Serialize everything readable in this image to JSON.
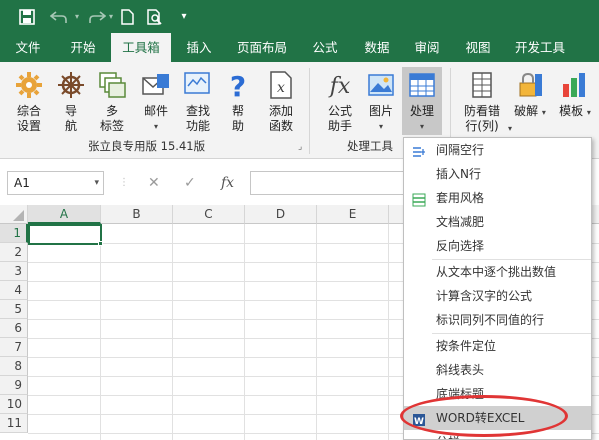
{
  "titlebar": {
    "save_icon": "save-icon",
    "undo_icon": "undo-icon",
    "redo_icon": "redo-icon",
    "new_icon": "new-doc-icon",
    "preview_icon": "print-preview-icon",
    "customize_icon": "customize-qa-icon",
    "bg_color": "#217346"
  },
  "tabs": [
    {
      "label": "文件"
    },
    {
      "label": "开始"
    },
    {
      "label": "工具箱"
    },
    {
      "label": "插入"
    },
    {
      "label": "页面布局"
    },
    {
      "label": "公式"
    },
    {
      "label": "数据"
    },
    {
      "label": "审阅"
    },
    {
      "label": "视图"
    },
    {
      "label": "开发工具"
    }
  ],
  "ribbon": {
    "buttons": [
      {
        "label": "综合\n设置",
        "icon": "settings-icon"
      },
      {
        "label": "导\n航",
        "icon": "helm-icon"
      },
      {
        "label": "多\n标签",
        "icon": "multi-tab-icon"
      },
      {
        "label": "邮件",
        "icon": "mail-icon",
        "caret": "▾"
      },
      {
        "label": "查找\n功能",
        "icon": "find-icon"
      },
      {
        "label": "帮\n助",
        "icon": "help-icon"
      },
      {
        "label": "添加\n函数",
        "icon": "add-function-icon"
      },
      {
        "label": "公式\n助手",
        "icon": "fx-icon"
      },
      {
        "label": "图片",
        "icon": "picture-icon",
        "caret": "▾"
      },
      {
        "label": "处理",
        "icon": "process-icon",
        "caret": "▾"
      },
      {
        "label": "防看错\n行(列)",
        "icon": "row-highlight-icon",
        "caret": "▾"
      },
      {
        "label": "破解",
        "icon": "crack-icon",
        "caret": "▾"
      },
      {
        "label": "模板",
        "icon": "template-icon",
        "caret": "▾"
      }
    ],
    "group1": "张立良专用版 15.41版",
    "group2": "处理工具"
  },
  "formula_bar": {
    "name_box": "A1",
    "fx_label": "fx",
    "cancel": "✕",
    "confirm": "✓"
  },
  "grid": {
    "columns": [
      "A",
      "B",
      "C",
      "D",
      "E"
    ],
    "rows": [
      "1",
      "2",
      "3",
      "4",
      "5",
      "6",
      "7",
      "8",
      "9",
      "10",
      "11"
    ]
  },
  "menu": {
    "items": [
      {
        "label": "间隔空行",
        "icon": "blank-row-icon"
      },
      {
        "label": "插入N行",
        "icon": ""
      },
      {
        "label": "套用风格",
        "icon": "style-icon"
      },
      {
        "label": "文档减肥",
        "icon": ""
      },
      {
        "label": "反向选择",
        "icon": ""
      },
      {
        "label": "从文本中逐个挑出数值",
        "icon": ""
      },
      {
        "label": "计算含汉字的公式",
        "icon": ""
      },
      {
        "label": "标识同列不同值的行",
        "icon": ""
      },
      {
        "label": "按条件定位",
        "icon": ""
      },
      {
        "label": "斜线表头",
        "icon": ""
      },
      {
        "label": "底端标题",
        "icon": ""
      },
      {
        "label": "WORD转EXCEL",
        "icon": "word-to-excel-icon"
      },
      {
        "label": "分栏",
        "icon": ""
      }
    ]
  },
  "annotation": {
    "color": "#e03535"
  }
}
